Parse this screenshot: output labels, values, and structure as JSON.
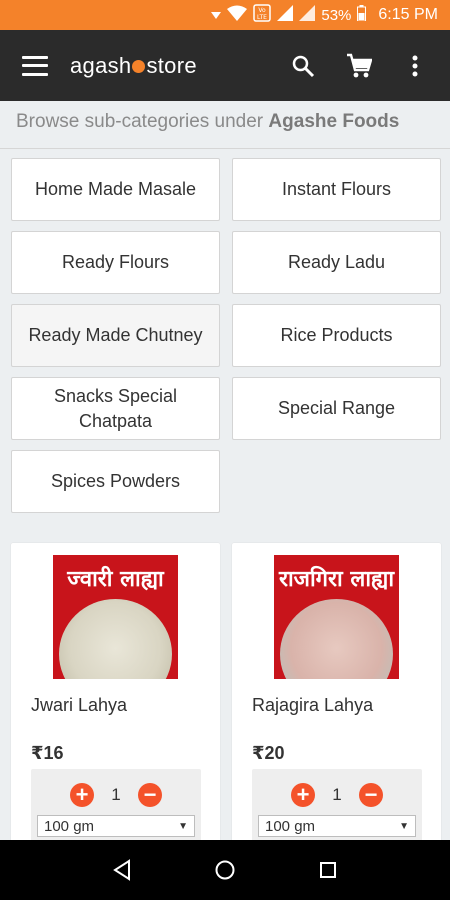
{
  "status_bar": {
    "battery": "53%",
    "time": "6:15 PM",
    "icons": [
      "signal-down-arrow-icon",
      "wifi-icon",
      "volte-icon",
      "signal-icon",
      "signal-icon",
      "battery-icon"
    ]
  },
  "app_bar": {
    "logo_part1": "agash",
    "logo_part2": "store",
    "menu_icon": "hamburger-menu-icon",
    "search_icon": "search-icon",
    "cart_icon": "cart-icon",
    "overflow_icon": "more-vert-icon"
  },
  "browse": {
    "prefix": "Browse sub-categories under ",
    "category": "Agashe Foods"
  },
  "subcategories": [
    "Home Made Masale",
    "Instant Flours",
    "Ready Flours",
    "Ready Ladu",
    "Ready Made Chutney",
    "Rice Products",
    "Snacks Special Chatpata",
    "Special Range",
    "Spices Powders"
  ],
  "products": [
    {
      "name": "Jwari Lahya",
      "image_label": "ज्वारी लाह्या",
      "price": "₹16",
      "quantity": "1",
      "size": "100 gm"
    },
    {
      "name": "Rajagira Lahya",
      "image_label": "राजगिरा लाह्या",
      "price": "₹20",
      "quantity": "1",
      "size": "100 gm"
    }
  ],
  "nav_bar": {
    "back_icon": "back-triangle-icon",
    "home_icon": "home-circle-icon",
    "recents_icon": "recents-square-icon"
  },
  "colors": {
    "brand_orange": "#f4822a",
    "app_bar": "#2b2b2b",
    "qty_button": "#f4522a"
  }
}
